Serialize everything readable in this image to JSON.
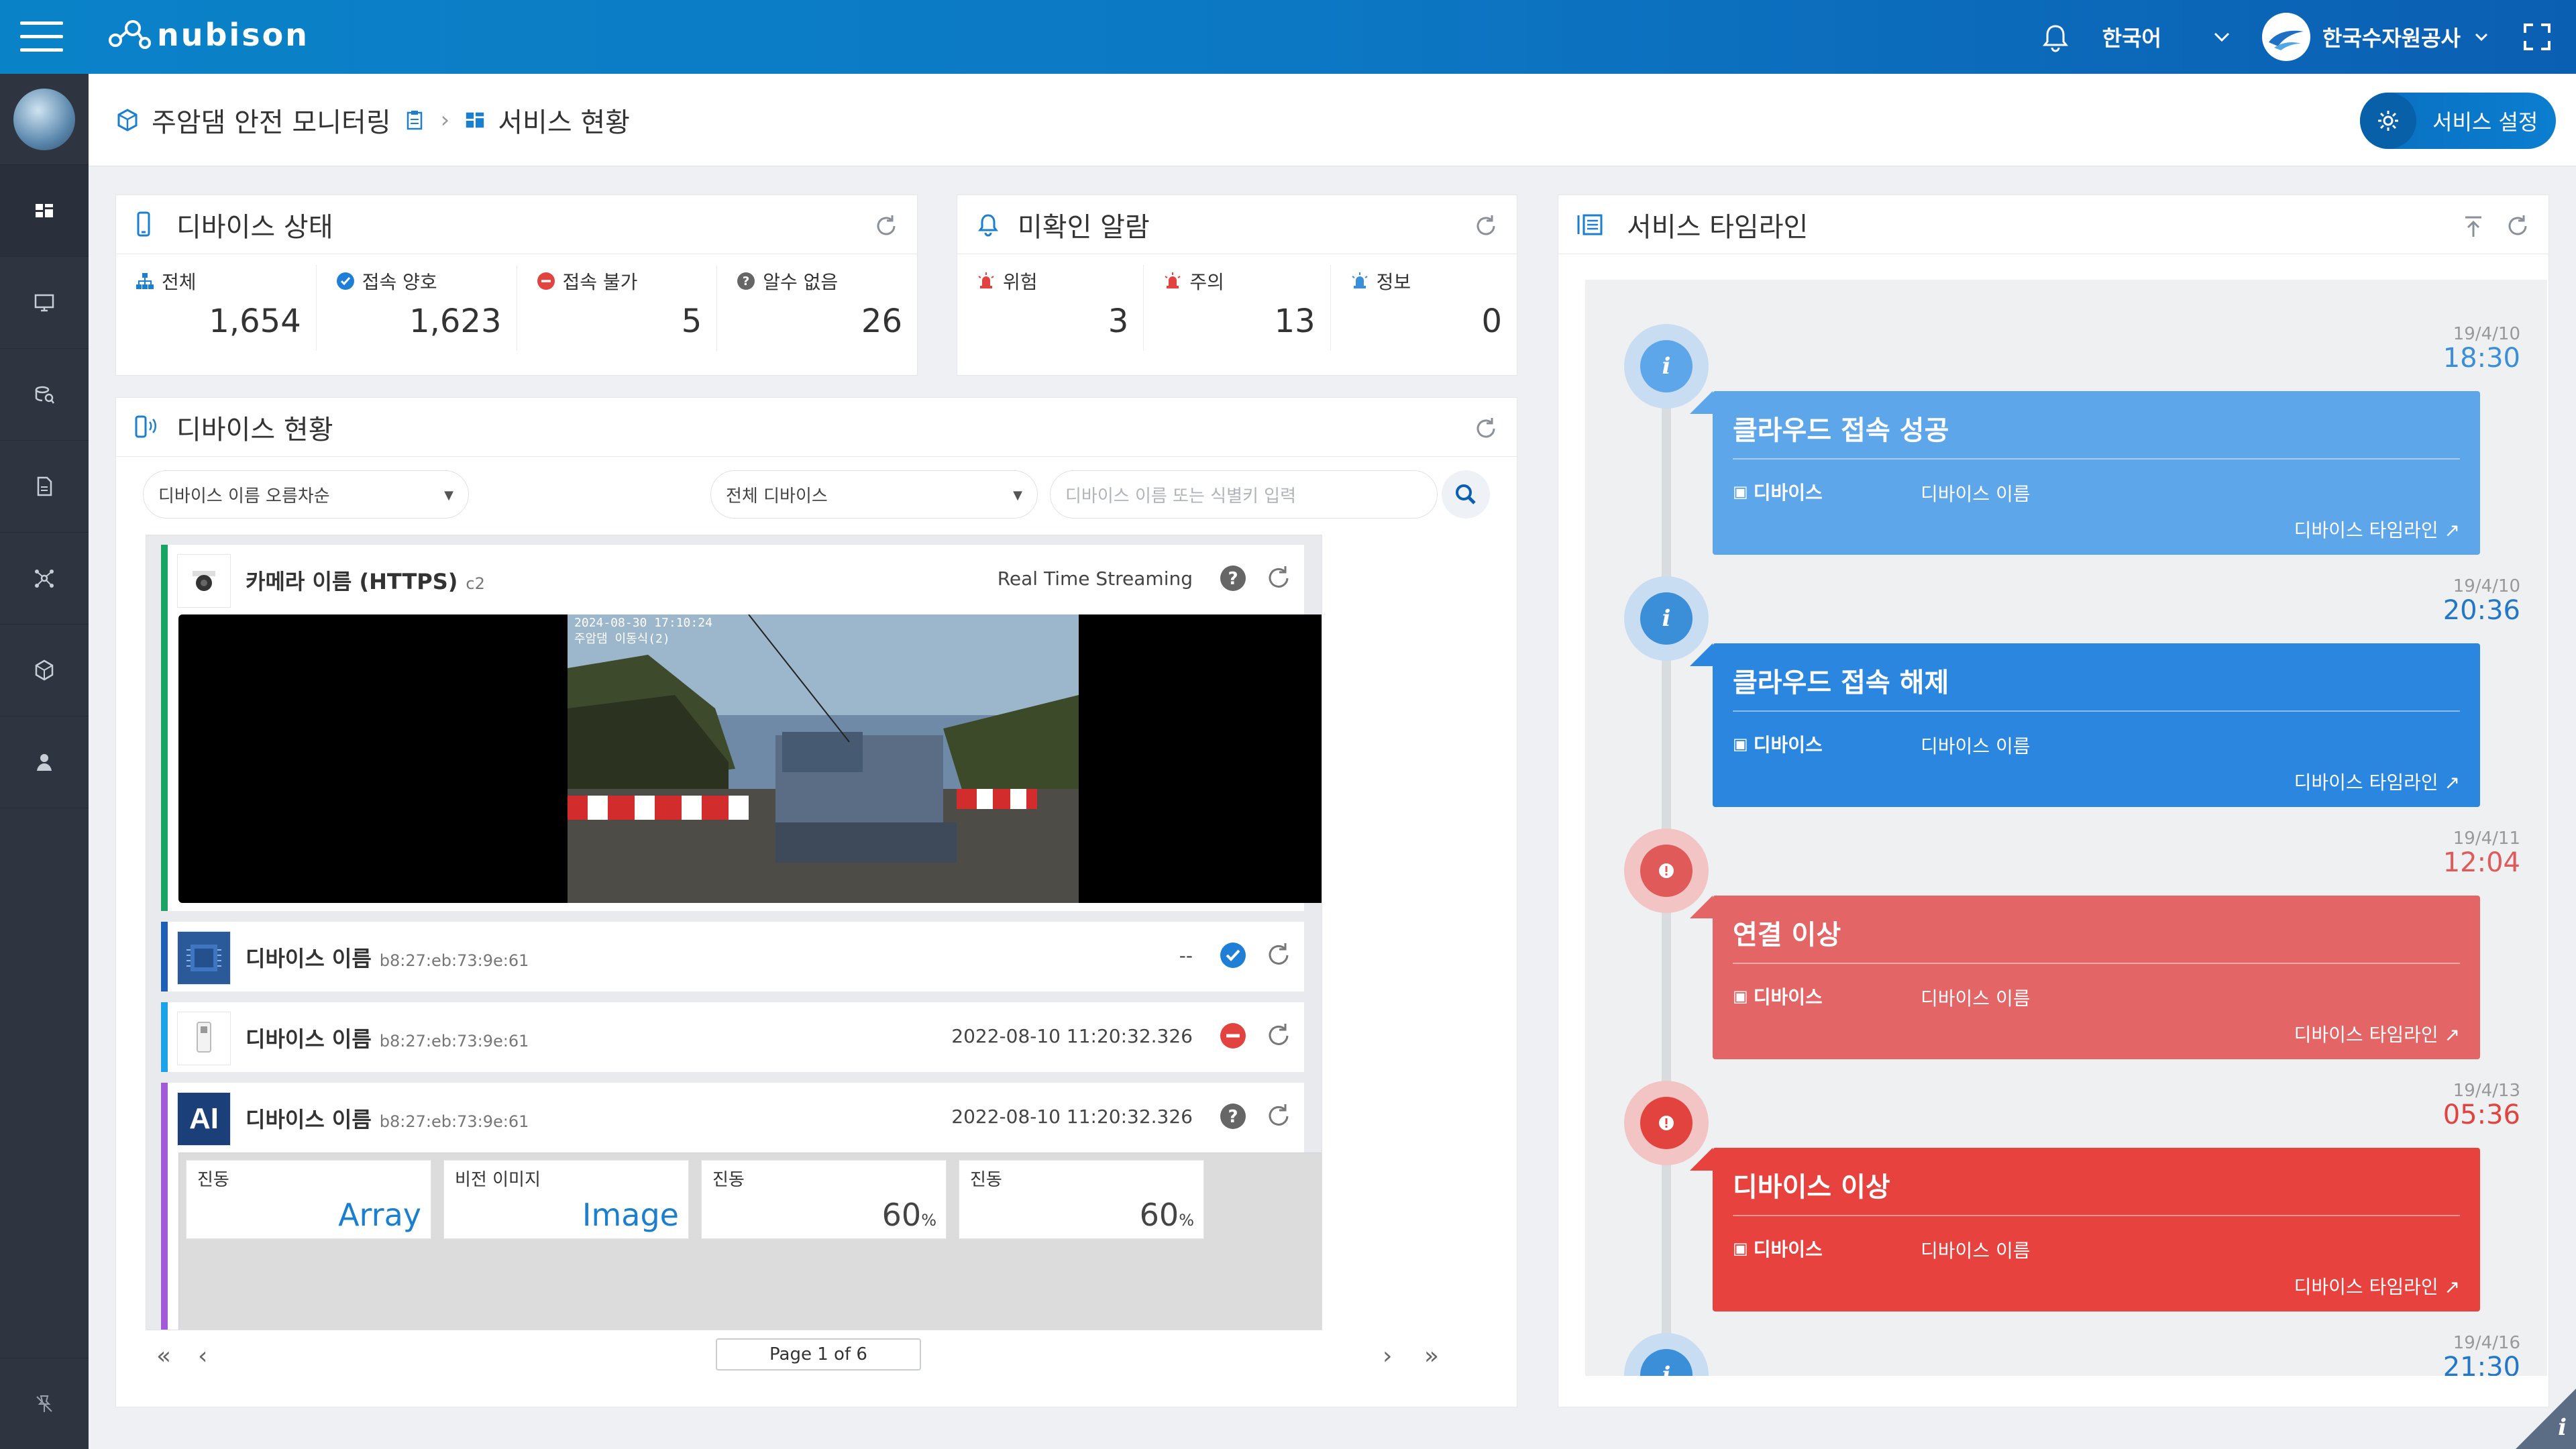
{
  "app": {
    "logo_text": "nubison"
  },
  "topbar": {
    "language": "한국어",
    "org_name": "한국수자원공사"
  },
  "breadcrumb": {
    "project": "주암댐 안전 모니터링",
    "page": "서비스 현황"
  },
  "header": {
    "settings_label": "서비스 설정"
  },
  "device_status": {
    "title": "디바이스 상태",
    "stats": [
      {
        "label": "전체",
        "value": "1,654"
      },
      {
        "label": "접속 양호",
        "value": "1,623"
      },
      {
        "label": "접속 불가",
        "value": "5"
      },
      {
        "label": "알수 없음",
        "value": "26"
      }
    ]
  },
  "alarms": {
    "title": "미확인 알람",
    "stats": [
      {
        "label": "위험",
        "value": "3"
      },
      {
        "label": "주의",
        "value": "13"
      },
      {
        "label": "정보",
        "value": "0"
      }
    ]
  },
  "device_list": {
    "title": "디바이스 현황",
    "sort_select": "디바이스 이름 오름차순",
    "filter_select": "전체 디바이스",
    "search_placeholder": "디바이스 이름 또는 식별키 입력",
    "camera": {
      "name": "카메라 이름 (HTTPS)",
      "id": "c2",
      "status_text": "Real Time Streaming",
      "overlay_time": "2024-08-30 17:10:24",
      "overlay_label": "주암댐 이동식(2)"
    },
    "devices": [
      {
        "name": "디바이스 이름",
        "id": "b8:27:eb:73:9e:61",
        "status_text": "--"
      },
      {
        "name": "디바이스 이름",
        "id": "b8:27:eb:73:9e:61",
        "status_text": "2022-08-10 11:20:32.326"
      },
      {
        "name": "디바이스 이름",
        "id": "b8:27:eb:73:9e:61",
        "status_text": "2022-08-10 11:20:32.326",
        "icon_text": "AI"
      }
    ],
    "ai_cells": [
      {
        "label": "진동",
        "value": "Array",
        "unit": ""
      },
      {
        "label": "비전 이미지",
        "value": "Image",
        "unit": ""
      },
      {
        "label": "진동",
        "value": "60",
        "unit": "%"
      },
      {
        "label": "진동",
        "value": "60",
        "unit": "%"
      }
    ],
    "pager": "Page 1 of 6"
  },
  "timeline": {
    "title": "서비스 타임라인",
    "events": [
      {
        "date": "19/4/10",
        "time": "18:30",
        "title": "클라우드 접속 성공",
        "device_label": "디바이스",
        "device_value": "디바이스 이름",
        "link": "디바이스 타임라인 ↗"
      },
      {
        "date": "19/4/10",
        "time": "20:36",
        "title": "클라우드 접속 해제",
        "device_label": "디바이스",
        "device_value": "디바이스 이름",
        "link": "디바이스 타임라인 ↗"
      },
      {
        "date": "19/4/11",
        "time": "12:04",
        "title": "연결 이상",
        "device_label": "디바이스",
        "device_value": "디바이스 이름",
        "link": "디바이스 타임라인 ↗"
      },
      {
        "date": "19/4/13",
        "time": "05:36",
        "title": "디바이스 이상",
        "device_label": "디바이스",
        "device_value": "디바이스 이름",
        "link": "디바이스 타임라인 ↗"
      },
      {
        "date": "19/4/16",
        "time": "21:30"
      }
    ]
  },
  "colors": {
    "brand": "#0b7bc6",
    "sidebar": "#2e3440",
    "ok": "#1f7fd6",
    "danger": "#e2433f",
    "info": "#5ea6ea"
  }
}
